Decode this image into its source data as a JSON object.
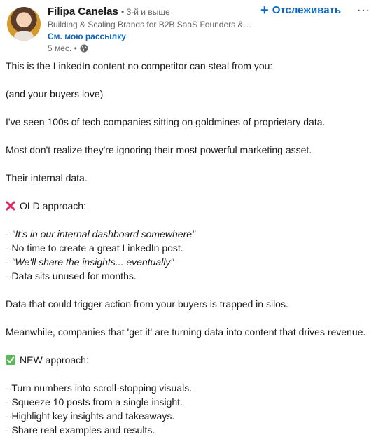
{
  "author": {
    "name": "Filipa Canelas",
    "degree": "• 3-й и выше",
    "headline": "Building & Scaling Brands for B2B SaaS Founders & C...",
    "newsletter_link": "См. мою рассылку",
    "time": "5 мес. •"
  },
  "actions": {
    "follow_label": "Отслеживать",
    "more_label": "···"
  },
  "post": {
    "line1": "This is the LinkedIn content no competitor can steal from you:",
    "line2": "(and your buyers love)",
    "line3": "I've seen 100s of tech companies sitting on goldmines of proprietary data.",
    "line4": "Most don't realize they're ignoring their most powerful marketing asset.",
    "line5": "Their internal data.",
    "old_heading": "OLD approach:",
    "old_items": [
      "\"It's in our internal dashboard somewhere\"",
      "- No time to create a great LinkedIn post.",
      "\"We'll share the insights... eventually\"",
      "- Data sits unused for months."
    ],
    "line6": "Data that could trigger action from your buyers is trapped in silos.",
    "line7": "Meanwhile, companies that 'get it' are turning data into content that drives revenue.",
    "new_heading": "NEW approach:",
    "new_items": [
      "- Turn numbers into scroll-stopping visuals.",
      "- Squeeze 10 posts from a single insight.",
      "- Highlight key insights and takeaways.",
      "- Share real examples and results."
    ]
  },
  "icons": {
    "cross": "cross-mark-emoji",
    "check": "check-mark-emoji",
    "globe": "globe-icon"
  },
  "colors": {
    "accent": "#0a66c2",
    "cross": "#e0245e",
    "check": "#5cb85c"
  }
}
